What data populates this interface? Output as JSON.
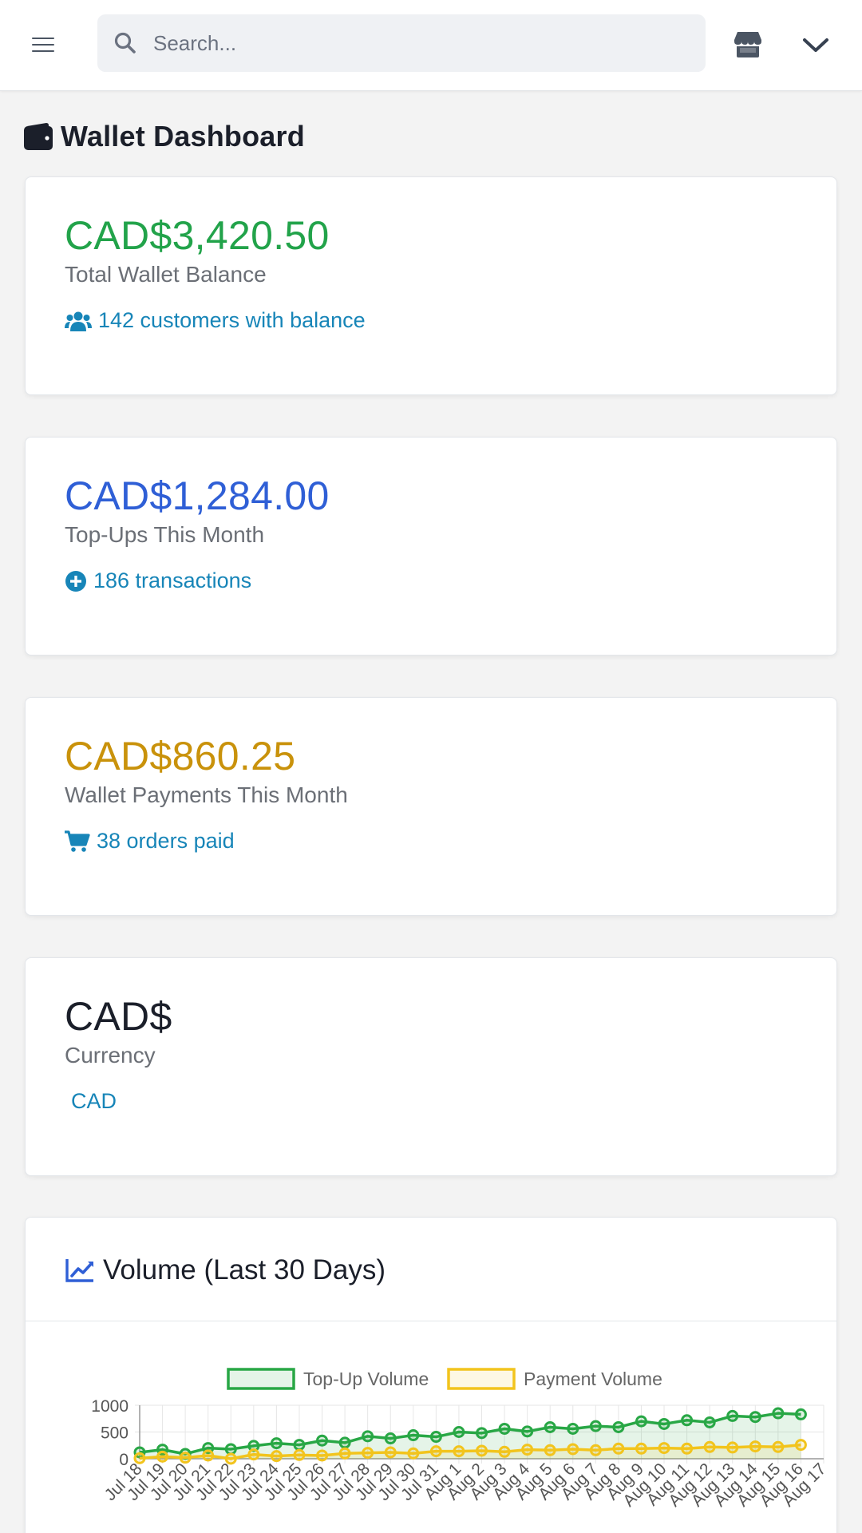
{
  "search": {
    "placeholder": "Search..."
  },
  "page": {
    "title": "Wallet Dashboard"
  },
  "cards": [
    {
      "amount": "CAD$3,420.50",
      "label": "Total Wallet Balance",
      "meta": "142 customers with balance",
      "color": "#22a34a",
      "icon": "users-icon"
    },
    {
      "amount": "CAD$1,284.00",
      "label": "Top-Ups This Month",
      "meta": "186 transactions",
      "color": "#2f5fd6",
      "icon": "plus-circle-icon"
    },
    {
      "amount": "CAD$860.25",
      "label": "Wallet Payments This Month",
      "meta": "38 orders paid",
      "color": "#c9920b",
      "icon": "cart-icon"
    },
    {
      "amount": "CAD$",
      "label": "Currency",
      "meta": "CAD",
      "color": "#1b1f2a",
      "icon": ""
    }
  ],
  "chart": {
    "title": "Volume (Last 30 Days)"
  },
  "chart_data": {
    "type": "line",
    "x": [
      "Jul 18",
      "Jul 19",
      "Jul 20",
      "Jul 21",
      "Jul 22",
      "Jul 23",
      "Jul 24",
      "Jul 25",
      "Jul 26",
      "Jul 27",
      "Jul 28",
      "Jul 29",
      "Jul 30",
      "Jul 31",
      "Aug 1",
      "Aug 2",
      "Aug 3",
      "Aug 4",
      "Aug 5",
      "Aug 6",
      "Aug 7",
      "Aug 8",
      "Aug 9",
      "Aug 10",
      "Aug 11",
      "Aug 12",
      "Aug 13",
      "Aug 14",
      "Aug 15",
      "Aug 16",
      "Aug 17"
    ],
    "series": [
      {
        "name": "Top-Up Volume",
        "color": "#28a745",
        "values": [
          120,
          170,
          90,
          200,
          180,
          240,
          290,
          260,
          340,
          300,
          420,
          380,
          440,
          410,
          500,
          480,
          560,
          510,
          590,
          560,
          610,
          590,
          700,
          650,
          720,
          680,
          800,
          780,
          850,
          830
        ]
      },
      {
        "name": "Payment Volume",
        "color": "#f2c41d",
        "values": [
          10,
          40,
          20,
          60,
          0,
          80,
          50,
          70,
          60,
          100,
          110,
          120,
          100,
          140,
          140,
          150,
          130,
          170,
          160,
          180,
          160,
          190,
          190,
          200,
          190,
          220,
          210,
          230,
          220,
          260
        ]
      }
    ],
    "ylim": [
      0,
      1000
    ],
    "yticks": [
      0,
      500,
      1000
    ],
    "grid": true,
    "legend": "top"
  }
}
